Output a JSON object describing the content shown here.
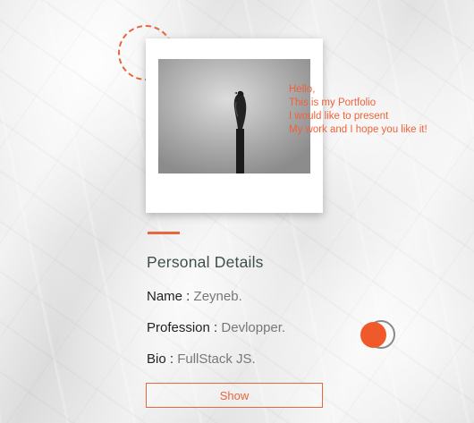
{
  "greeting": {
    "lines": [
      "Hello,",
      "This is my Portfolio",
      "I would like to present",
      "My work and I hope you like it!"
    ]
  },
  "photo": {
    "subject": "bird perched on a post (monochrome)"
  },
  "section": {
    "title": "Personal Details"
  },
  "details": {
    "name_key": "Name :",
    "name_value": "Zeyneb.",
    "profession_key": "Profession :",
    "profession_value": "Devlopper.",
    "bio_key": "Bio :",
    "bio_value": "FullStack JS."
  },
  "theme_toggle": {
    "icon": "toggle-icon"
  },
  "actions": {
    "show_label": "Show"
  },
  "colors": {
    "accent": "#e8663d",
    "greeting": "#f0623a",
    "title": "#3f4f4a",
    "value_text": "#777777"
  }
}
